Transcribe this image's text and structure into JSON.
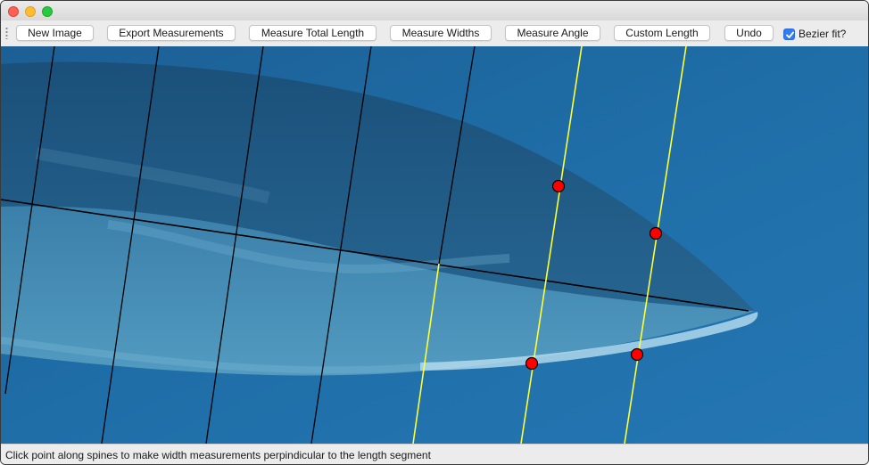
{
  "toolbar": {
    "buttons": [
      {
        "label": "New Image"
      },
      {
        "label": "Export Measurements"
      },
      {
        "label": "Measure Total Length"
      },
      {
        "label": "Measure Widths"
      },
      {
        "label": "Measure Angle"
      },
      {
        "label": "Custom Length"
      },
      {
        "label": "Undo"
      }
    ],
    "checkbox": {
      "label": "Bezier fit?",
      "checked": true
    }
  },
  "status": {
    "message": "Click point along spines to make width measurements perpindicular to the length segment"
  },
  "colors": {
    "water": "#1f6ea8",
    "spine_line": "#000000",
    "width_line": "#ffff33",
    "marker_fill": "#ff0000",
    "checkbox_accent": "#2f7cf6"
  },
  "icons": {
    "close": "close-icon",
    "minimize": "minimize-icon",
    "maximize": "maximize-icon",
    "checkmark": "checkmark-icon",
    "toolbar_grip": "grip-icon"
  }
}
